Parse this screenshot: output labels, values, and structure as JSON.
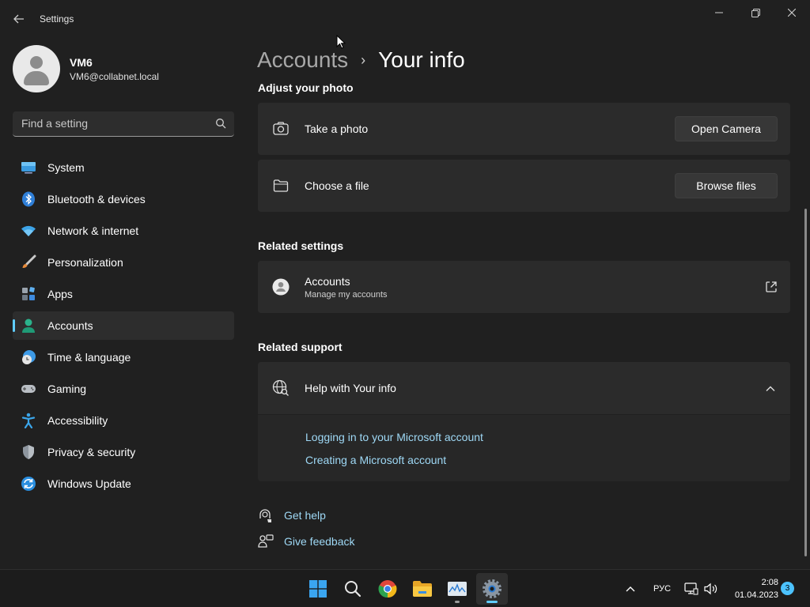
{
  "window": {
    "title": "Settings",
    "back_icon": "back-arrow-icon",
    "controls": [
      "minimize-icon",
      "maximize-icon",
      "close-icon"
    ]
  },
  "profile": {
    "name": "VM6",
    "email": "VM6@collabnet.local"
  },
  "search": {
    "placeholder": "Find a setting",
    "value": ""
  },
  "nav": {
    "items": [
      {
        "label": "System",
        "icon": "system-icon",
        "active": false
      },
      {
        "label": "Bluetooth & devices",
        "icon": "bluetooth-icon",
        "active": false
      },
      {
        "label": "Network & internet",
        "icon": "wifi-icon",
        "active": false
      },
      {
        "label": "Personalization",
        "icon": "paintbrush-icon",
        "active": false
      },
      {
        "label": "Apps",
        "icon": "apps-icon",
        "active": false
      },
      {
        "label": "Accounts",
        "icon": "accounts-icon",
        "active": true
      },
      {
        "label": "Time & language",
        "icon": "time-language-icon",
        "active": false
      },
      {
        "label": "Gaming",
        "icon": "gamepad-icon",
        "active": false
      },
      {
        "label": "Accessibility",
        "icon": "accessibility-icon",
        "active": false
      },
      {
        "label": "Privacy & security",
        "icon": "shield-icon",
        "active": false
      },
      {
        "label": "Windows Update",
        "icon": "update-icon",
        "active": false
      }
    ]
  },
  "breadcrumb": {
    "parent": "Accounts",
    "separator": "›",
    "current": "Your info"
  },
  "photo": {
    "section_title": "Adjust your photo",
    "take_photo": {
      "label": "Take a photo",
      "button": "Open Camera"
    },
    "choose_file": {
      "label": "Choose a file",
      "button": "Browse files"
    }
  },
  "related_settings": {
    "section_title": "Related settings",
    "accounts": {
      "label": "Accounts",
      "sublabel": "Manage my accounts"
    }
  },
  "related_support": {
    "section_title": "Related support",
    "help": {
      "label": "Help with Your info"
    },
    "links": [
      "Logging in to your Microsoft account",
      "Creating a Microsoft account"
    ]
  },
  "bottom_links": {
    "get_help": "Get help",
    "give_feedback": "Give feedback"
  },
  "taskbar": {
    "apps": [
      "windows-start-icon",
      "search-icon",
      "chrome-icon",
      "file-explorer-icon",
      "task-manager-icon",
      "settings-icon"
    ],
    "language": "РУС",
    "time": "2:08",
    "date": "01.04.2023",
    "notifications": "3"
  },
  "colors": {
    "accent": "#60cdff",
    "link": "#9ed8f5",
    "background": "#202020",
    "card": "#2b2b2b"
  }
}
